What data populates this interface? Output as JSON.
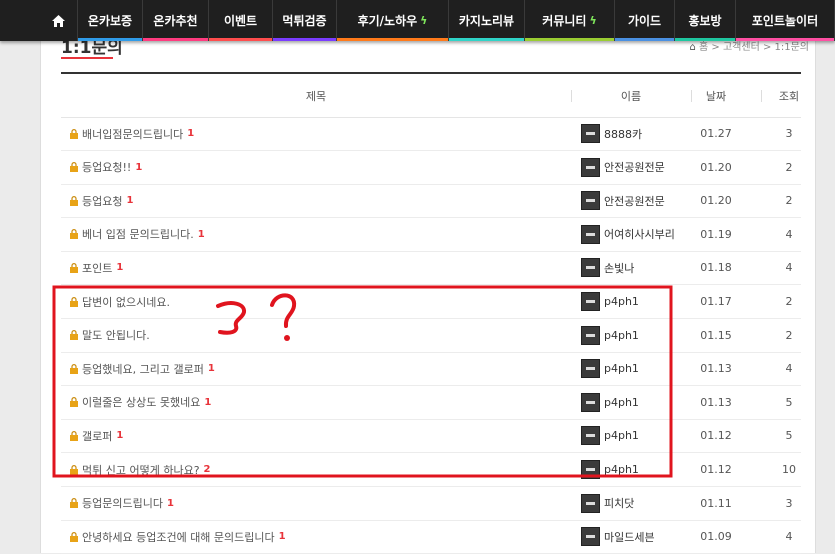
{
  "nav": {
    "items": [
      {
        "label": "온카보증",
        "color": "#2f9be8",
        "bolt": false
      },
      {
        "label": "온카추천",
        "color": "#ff3b7f",
        "bolt": false
      },
      {
        "label": "이벤트",
        "color": "#ff4d4d",
        "bolt": false
      },
      {
        "label": "먹튀검증",
        "color": "#7a3cff",
        "bolt": false
      },
      {
        "label": "후기/노하우",
        "color": "#ff7a1a",
        "bolt": true
      },
      {
        "label": "카지노리뷰",
        "color": "#2fd4c8",
        "bolt": false
      },
      {
        "label": "커뮤니티",
        "color": "#9acd32",
        "bolt": true
      },
      {
        "label": "가이드",
        "color": "#4a90e2",
        "bolt": false
      },
      {
        "label": "홍보방",
        "color": "#1ec7a0",
        "bolt": false
      },
      {
        "label": "포인트놀이터",
        "color": "#ff4fa3",
        "bolt": false
      }
    ]
  },
  "page": {
    "title": "1:1문의",
    "breadcrumb": "홈 > 고객센터 > 1:1문의"
  },
  "table": {
    "headers": {
      "title": "제목",
      "name": "이름",
      "date": "날짜",
      "views": "조회"
    },
    "rows": [
      {
        "title": "배너입점문의드립니다",
        "comments": "1",
        "name": "8888카",
        "date": "01.27",
        "views": "3"
      },
      {
        "title": "등업요청!!",
        "comments": "1",
        "name": "안전공원전문",
        "date": "01.20",
        "views": "2"
      },
      {
        "title": "등업요청",
        "comments": "1",
        "name": "안전공원전문",
        "date": "01.20",
        "views": "2"
      },
      {
        "title": "베너 입점 문의드립니다.",
        "comments": "1",
        "name": "어여히사시부리",
        "date": "01.19",
        "views": "4"
      },
      {
        "title": "포인트",
        "comments": "1",
        "name": "손빛나",
        "date": "01.18",
        "views": "4"
      },
      {
        "title": "답변이 없으시네요.",
        "comments": "",
        "name": "p4ph1",
        "date": "01.17",
        "views": "2"
      },
      {
        "title": "말도 안됩니다.",
        "comments": "",
        "name": "p4ph1",
        "date": "01.15",
        "views": "2"
      },
      {
        "title": "등업했네요, 그리고 갤로퍼",
        "comments": "1",
        "name": "p4ph1",
        "date": "01.13",
        "views": "4"
      },
      {
        "title": "이럴줄은 상상도 못했네요",
        "comments": "1",
        "name": "p4ph1",
        "date": "01.13",
        "views": "5"
      },
      {
        "title": "갤로퍼",
        "comments": "1",
        "name": "p4ph1",
        "date": "01.12",
        "views": "5"
      },
      {
        "title": "먹튀 신고 어떻게 하나요?",
        "comments": "2",
        "name": "p4ph1",
        "date": "01.12",
        "views": "10"
      },
      {
        "title": "등업문의드립니다",
        "comments": "1",
        "name": "피치닷",
        "date": "01.11",
        "views": "3"
      },
      {
        "title": "안녕하세요 등업조건에 대해 문의드립니다",
        "comments": "1",
        "name": "마일드세븐",
        "date": "01.09",
        "views": "4"
      }
    ]
  },
  "annotation": {
    "color": "#e0141e"
  }
}
